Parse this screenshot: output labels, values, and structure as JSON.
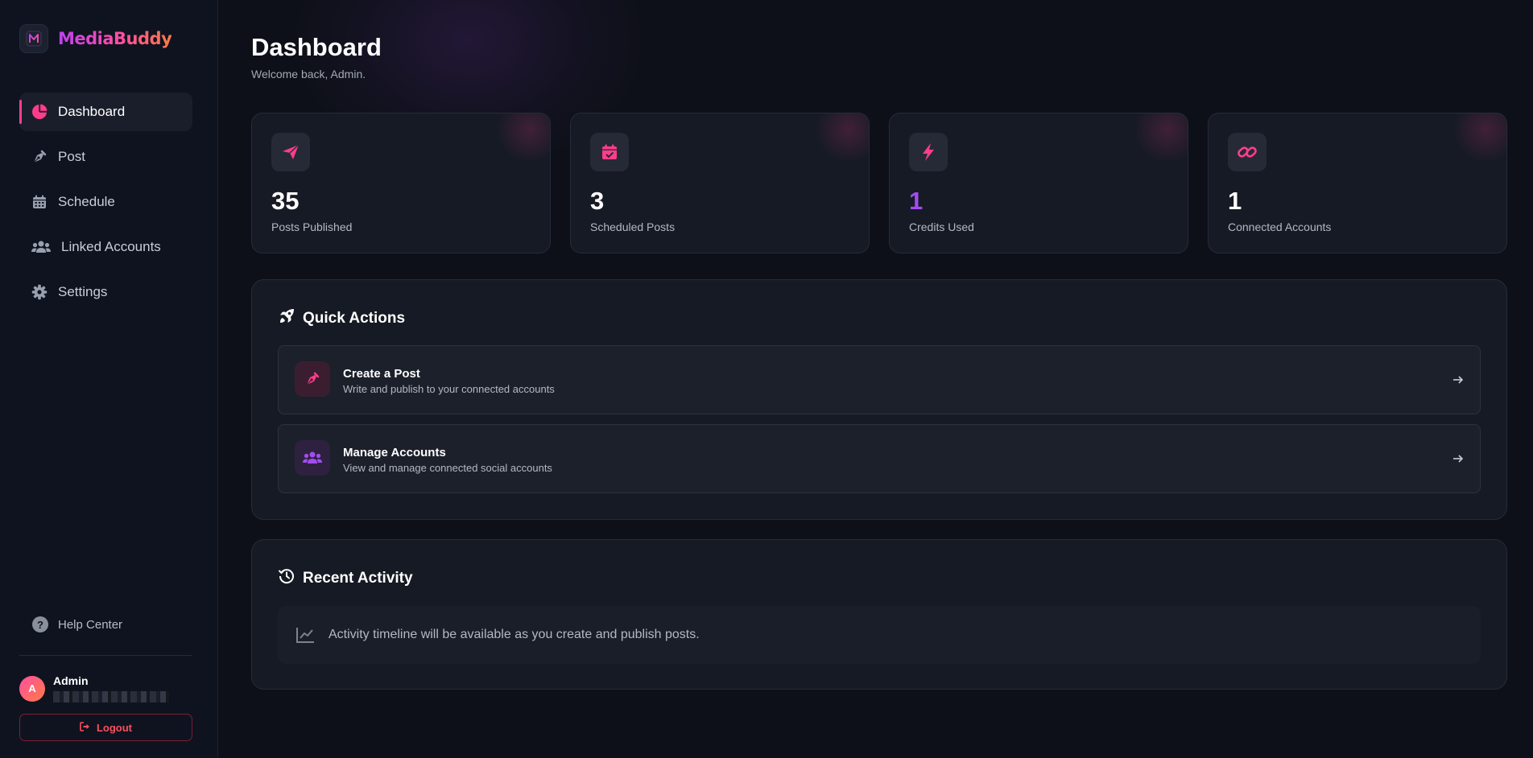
{
  "brand": {
    "name": "MediaBuddy"
  },
  "sidebar": {
    "items": [
      {
        "label": "Dashboard",
        "icon": "pie-chart-icon",
        "active": true
      },
      {
        "label": "Post",
        "icon": "pen-nib-icon"
      },
      {
        "label": "Schedule",
        "icon": "calendar-icon"
      },
      {
        "label": "Linked Accounts",
        "icon": "users-icon"
      },
      {
        "label": "Settings",
        "icon": "gear-icon"
      }
    ],
    "help_label": "Help Center",
    "user": {
      "initial": "A",
      "name": "Admin"
    },
    "logout_label": "Logout"
  },
  "header": {
    "title": "Dashboard",
    "subtitle": "Welcome back, Admin."
  },
  "stats": [
    {
      "value": "35",
      "label": "Posts Published",
      "icon": "paper-plane-icon"
    },
    {
      "value": "3",
      "label": "Scheduled Posts",
      "icon": "calendar-check-icon"
    },
    {
      "value": "1",
      "label": "Credits Used",
      "icon": "bolt-icon"
    },
    {
      "value": "1",
      "label": "Connected Accounts",
      "icon": "link-icon"
    }
  ],
  "quick_actions": {
    "title": "Quick Actions",
    "items": [
      {
        "title": "Create a Post",
        "description": "Write and publish to your connected accounts"
      },
      {
        "title": "Manage Accounts",
        "description": "View and manage connected social accounts"
      }
    ]
  },
  "recent_activity": {
    "title": "Recent Activity",
    "empty_text": "Activity timeline will be available as you create and publish posts."
  },
  "colors": {
    "accent_pink": "#ff3d8b",
    "accent_purple": "#a24cf0",
    "background": "#0d1018",
    "card": "#161a25",
    "logout_red": "#ff4f5e"
  }
}
